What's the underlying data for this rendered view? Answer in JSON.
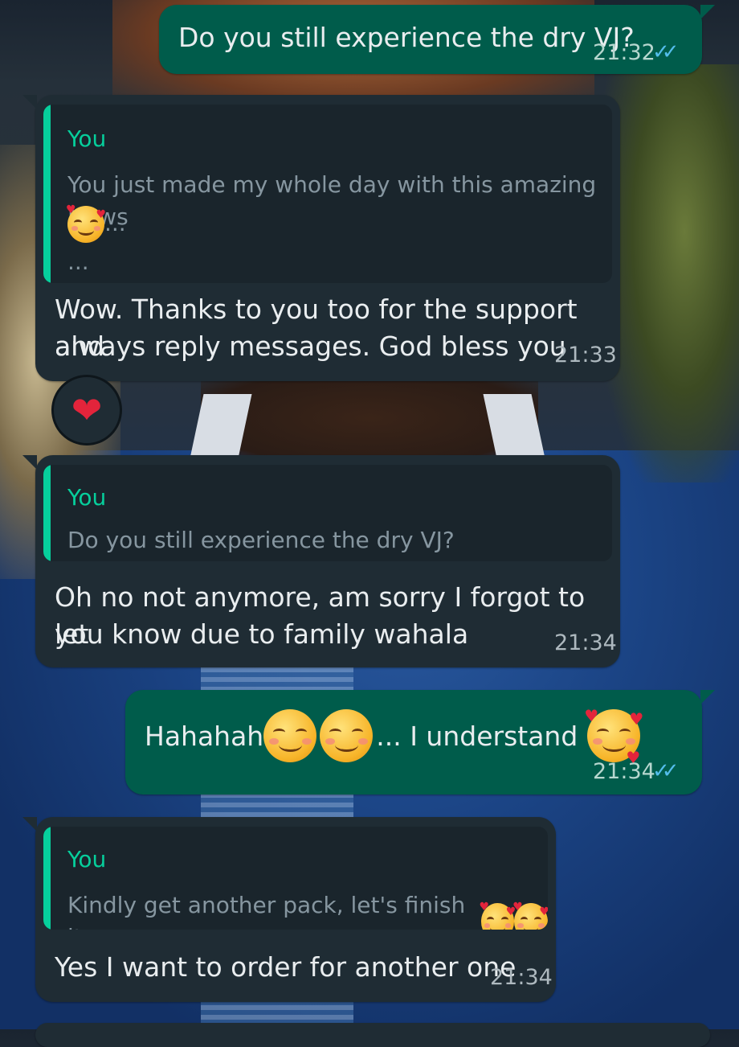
{
  "messages": [
    {
      "type": "outgoing",
      "text": "Do you still experience the dry VJ?",
      "time": "21:32",
      "status": "read"
    },
    {
      "type": "incoming",
      "quote": {
        "author": "You",
        "text": "You just made my whole day with this amazing News",
        "text_tail": "...",
        "extra": "..."
      },
      "text_line1": "Wow. Thanks to you too for the support and",
      "text_line2": "always reply messages. God bless you",
      "time": "21:33",
      "reaction": "heart"
    },
    {
      "type": "incoming",
      "quote": {
        "author": "You",
        "text": "Do you still experience the dry VJ?"
      },
      "text_line1": "Oh no not anymore, am sorry I forgot to let",
      "text_line2": "you know due to family wahala",
      "time": "21:34"
    },
    {
      "type": "outgoing",
      "text_a": "Hahahah",
      "text_b": "... I understand",
      "time": "21:34",
      "status": "read"
    },
    {
      "type": "incoming",
      "quote": {
        "author": "You",
        "text": "Kindly get another pack, let's finish it up"
      },
      "text": "Yes I want to order for another one",
      "time": "21:34"
    }
  ],
  "icons": {
    "read_ticks": "double-check-icon",
    "reaction": "red-heart-icon",
    "emoji_hearts": "smiling-face-with-hearts-icon",
    "emoji_smile": "smiling-face-with-smiling-eyes-icon"
  },
  "colors": {
    "incoming_bubble": "#1f2c34",
    "outgoing_bubble": "#005c4b",
    "quote_accent": "#06cf9c",
    "read_tick": "#53bdeb"
  }
}
